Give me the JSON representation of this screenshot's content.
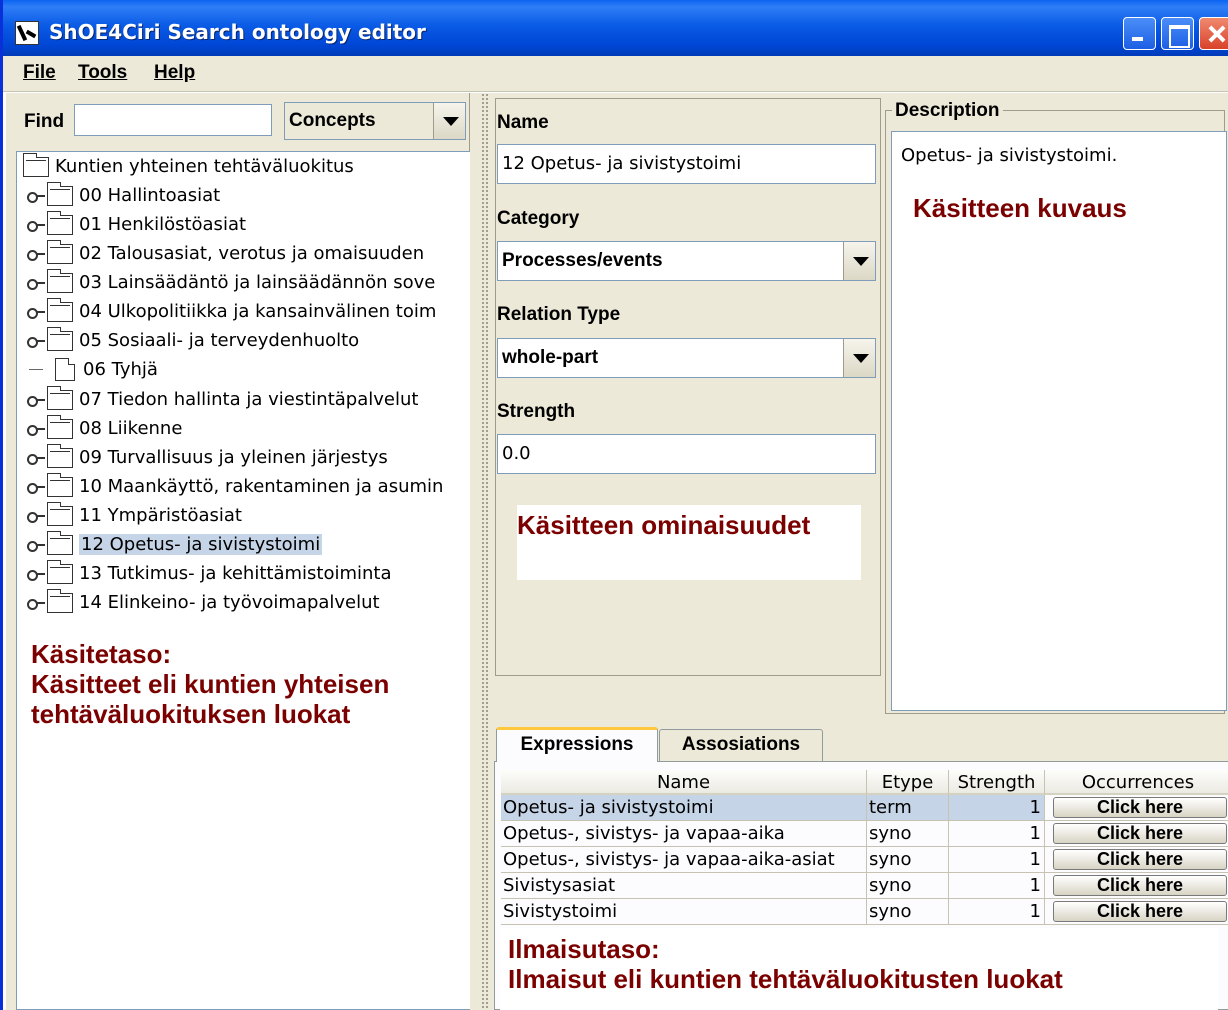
{
  "window": {
    "title": "ShOE4Ciri Search ontology editor"
  },
  "menu": [
    "File",
    "Tools",
    "Help"
  ],
  "left": {
    "find_label": "Find",
    "find_value": "",
    "search_type": "Concepts",
    "tree": {
      "root": "Kuntien yhteinen tehtäväluokitus",
      "items": [
        {
          "label": "00 Hallintoasiat",
          "type": "folder"
        },
        {
          "label": "01 Henkilöstöasiat",
          "type": "folder"
        },
        {
          "label": "02 Talousasiat, verotus ja omaisuuden",
          "type": "folder"
        },
        {
          "label": "03 Lainsäädäntö ja lainsäädännön sove",
          "type": "folder"
        },
        {
          "label": "04 Ulkopolitiikka ja kansainvälinen toim",
          "type": "folder"
        },
        {
          "label": "05 Sosiaali- ja terveydenhuolto",
          "type": "folder"
        },
        {
          "label": "06 Tyhjä",
          "type": "leaf"
        },
        {
          "label": "07 Tiedon hallinta ja viestintäpalvelut",
          "type": "folder"
        },
        {
          "label": "08 Liikenne",
          "type": "folder"
        },
        {
          "label": "09 Turvallisuus ja yleinen järjestys",
          "type": "folder"
        },
        {
          "label": "10 Maankäyttö, rakentaminen ja asumin",
          "type": "folder"
        },
        {
          "label": "11 Ympäristöasiat",
          "type": "folder"
        },
        {
          "label": "12 Opetus- ja sivistystoimi",
          "type": "folder",
          "selected": true
        },
        {
          "label": "13 Tutkimus- ja kehittämistoiminta",
          "type": "folder"
        },
        {
          "label": "14 Elinkeino- ja työvoimapalvelut",
          "type": "folder"
        }
      ]
    },
    "annotation": [
      "Käsitetaso:",
      "Käsitteet eli kuntien yhteisen",
      "tehtäväluokituksen luokat"
    ]
  },
  "properties": {
    "name_label": "Name",
    "name_value": "12 Opetus- ja sivistystoimi",
    "category_label": "Category",
    "category_value": "Processes/events",
    "relation_label": "Relation Type",
    "relation_value": "whole-part",
    "strength_label": "Strength",
    "strength_value": "0.0",
    "annotation": "Käsitteen ominaisuudet"
  },
  "description": {
    "title": "Description",
    "text": "Opetus- ja sivistystoimi.",
    "annotation": "Käsitteen kuvaus"
  },
  "tabs": [
    "Expressions",
    "Assosiations"
  ],
  "table": {
    "columns": [
      "Name",
      "Etype",
      "Strength",
      "Occurrences"
    ],
    "rows": [
      {
        "name": "Opetus- ja sivistystoimi",
        "etype": "term",
        "strength": "1",
        "occ": "Click here",
        "selected": true
      },
      {
        "name": "Opetus-, sivistys- ja vapaa-aika",
        "etype": "syno",
        "strength": "1",
        "occ": "Click here"
      },
      {
        "name": "Opetus-, sivistys- ja vapaa-aika-asiat",
        "etype": "syno",
        "strength": "1",
        "occ": "Click here"
      },
      {
        "name": "Sivistysasiat",
        "etype": "syno",
        "strength": "1",
        "occ": "Click here"
      },
      {
        "name": "Sivistystoimi",
        "etype": "syno",
        "strength": "1",
        "occ": "Click here"
      }
    ]
  },
  "expression_annotation": [
    "Ilmaisutaso:",
    "Ilmaisut eli kuntien tehtäväluokitusten luokat"
  ],
  "colors": {
    "titlebar": "#0a5be6",
    "annotation": "#7b0000",
    "selection": "#c5d4e6",
    "panel": "#ece9d8"
  }
}
